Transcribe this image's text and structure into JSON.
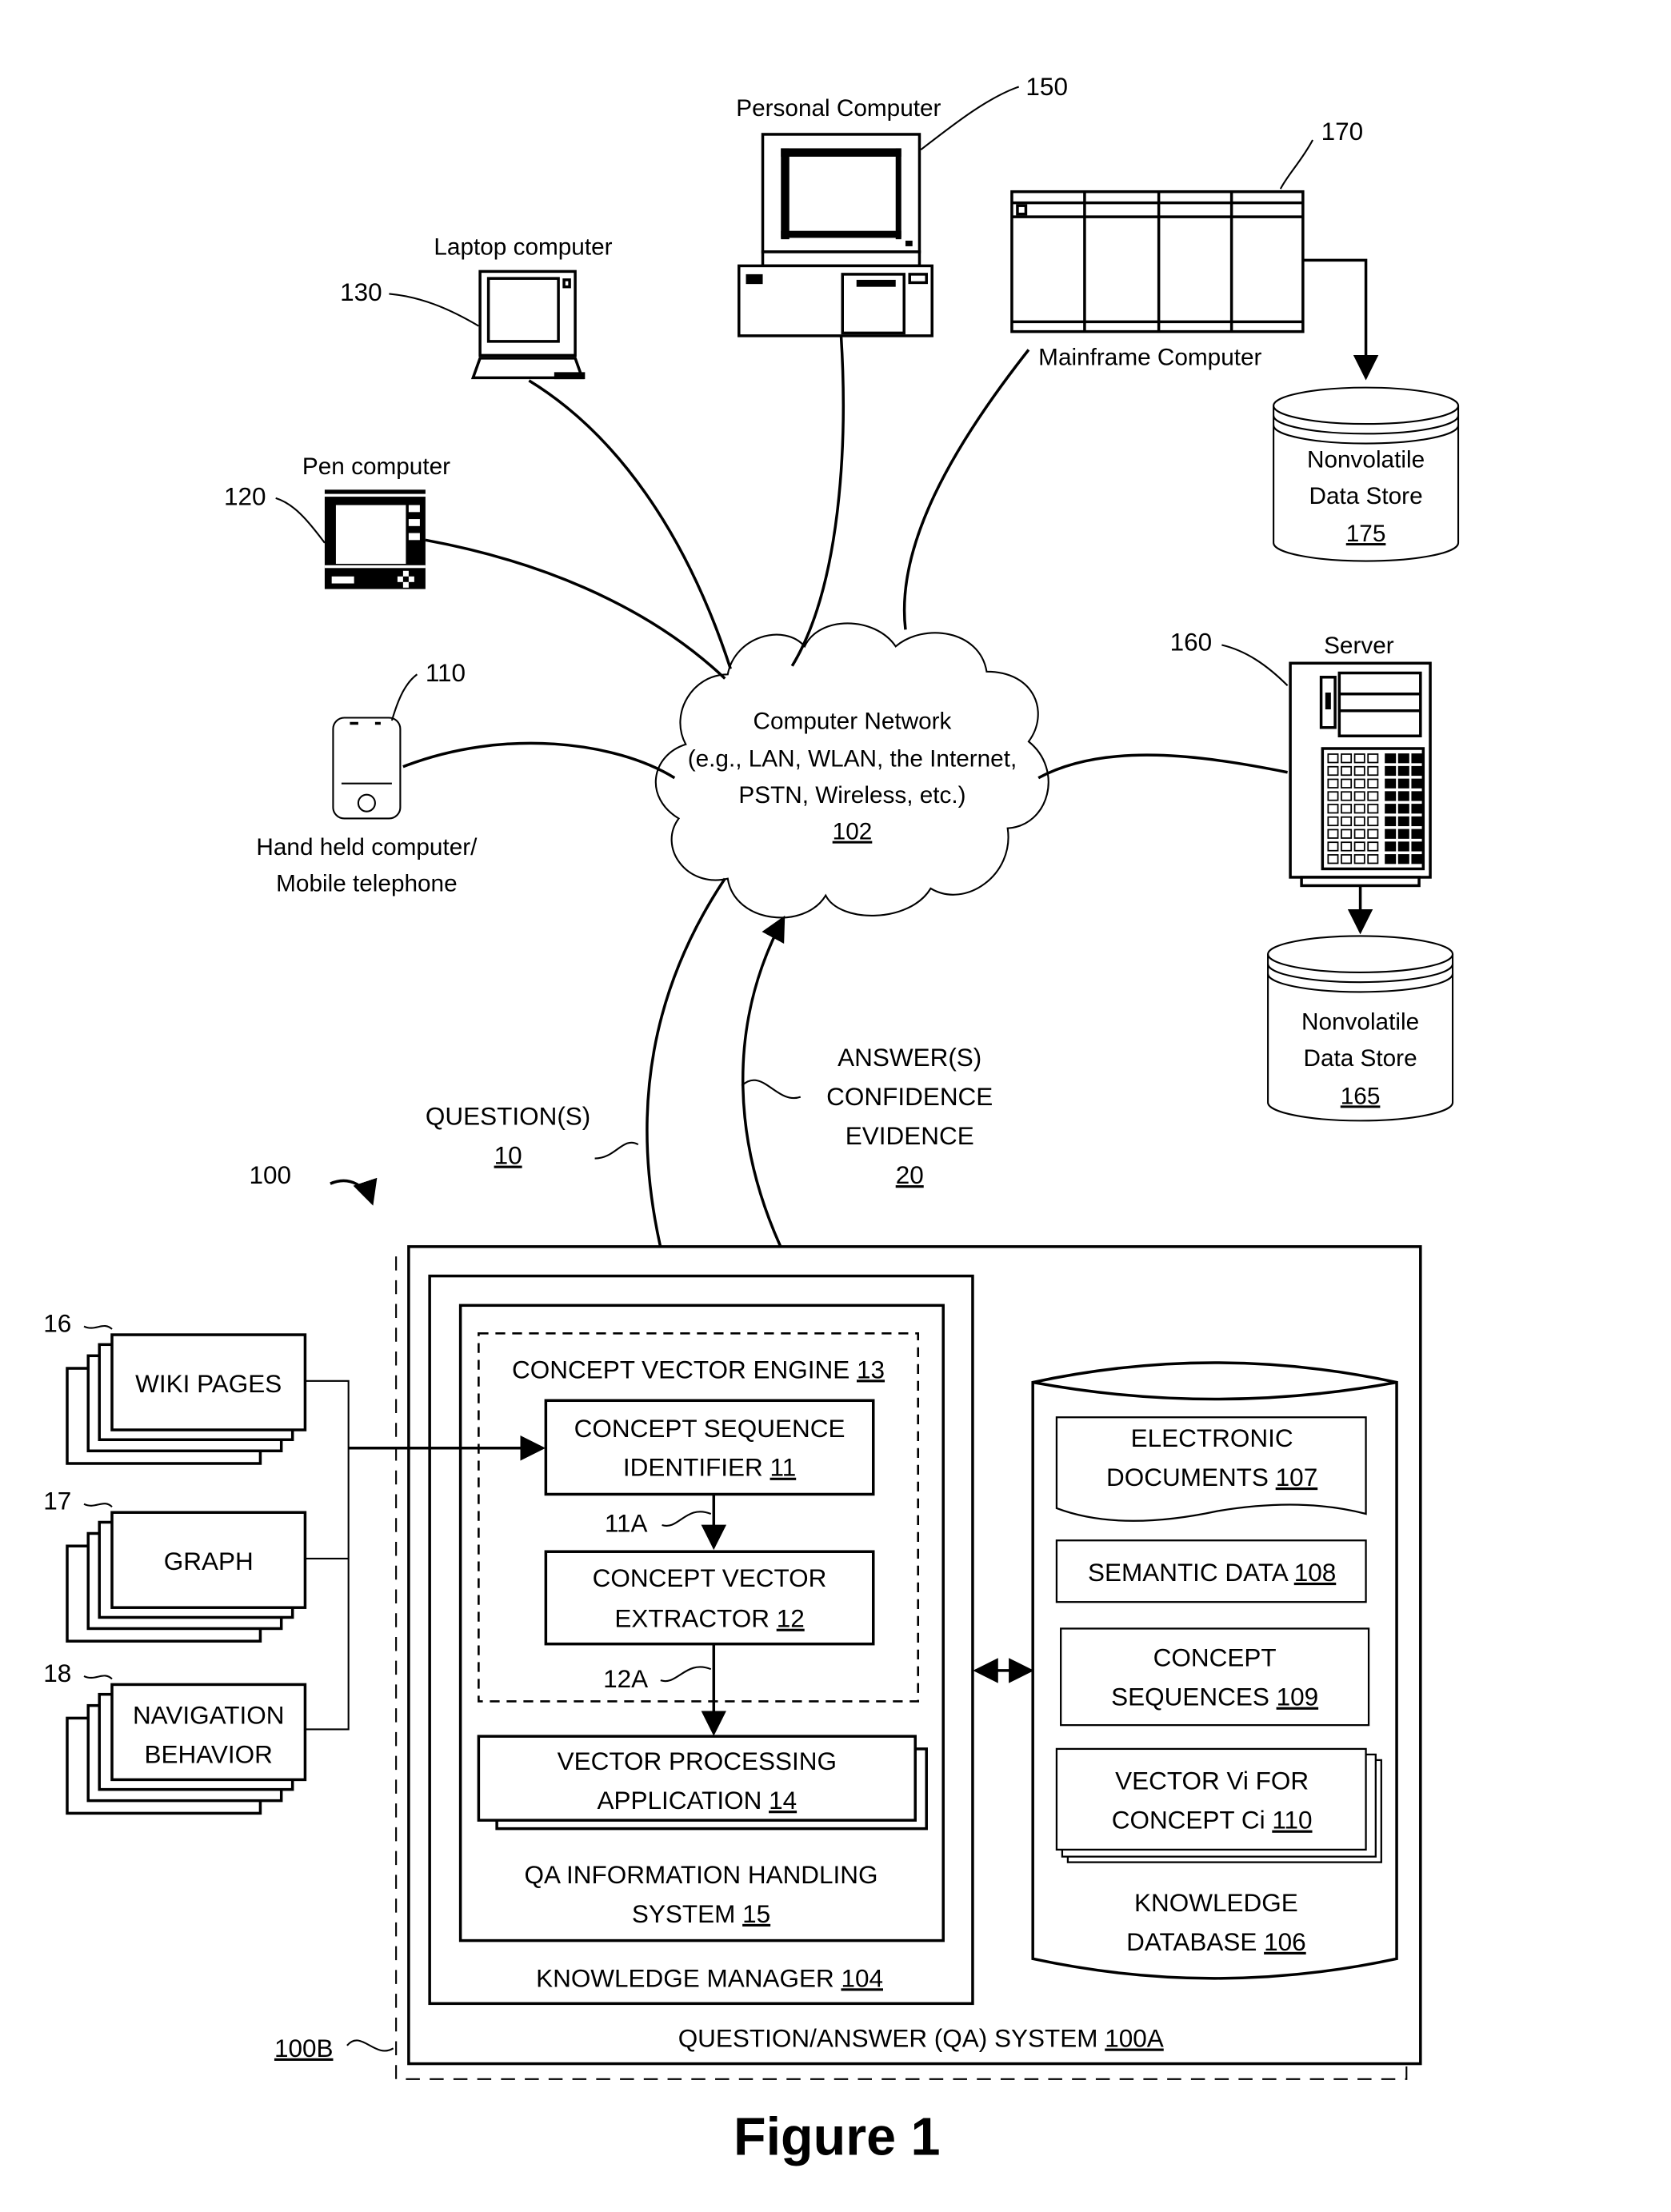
{
  "figure": {
    "caption": "Figure 1",
    "system_ref": "100",
    "outer_ref": "100B"
  },
  "devices": {
    "personal_computer": {
      "label": "Personal Computer",
      "ref": "150"
    },
    "mainframe": {
      "label": "Mainframe Computer",
      "ref": "170"
    },
    "laptop": {
      "label": "Laptop computer",
      "ref": "130"
    },
    "pen": {
      "label": "Pen computer",
      "ref": "120"
    },
    "handheld": {
      "label_line1": "Hand held computer/",
      "label_line2": "Mobile telephone",
      "ref": "110"
    },
    "server": {
      "label": "Server",
      "ref": "160"
    },
    "store_175": {
      "line1": "Nonvolatile",
      "line2": "Data Store",
      "ref": "175"
    },
    "store_165": {
      "line1": "Nonvolatile",
      "line2": "Data Store",
      "ref": "165"
    }
  },
  "network": {
    "line1": "Computer Network",
    "line2": "(e.g., LAN, WLAN, the Internet,",
    "line3": "PSTN, Wireless, etc.)",
    "ref": "102"
  },
  "flows": {
    "questions": {
      "label": "QUESTION(S)",
      "ref": "10"
    },
    "answers": {
      "line1": "ANSWER(S)",
      "line2": "CONFIDENCE",
      "line3": "EVIDENCE",
      "ref": "20"
    }
  },
  "sources": [
    {
      "ref": "16",
      "line1": "WIKI PAGES",
      "line2": ""
    },
    {
      "ref": "17",
      "line1": "GRAPH",
      "line2": ""
    },
    {
      "ref": "18",
      "line1": "NAVIGATION",
      "line2": "BEHAVIOR"
    }
  ],
  "qa_system": {
    "label": "QUESTION/ANSWER (QA) SYSTEM ",
    "ref": "100A",
    "knowledge_manager": {
      "label": "KNOWLEDGE MANAGER ",
      "ref": "104"
    },
    "qa_ihs": {
      "line1": "QA INFORMATION HANDLING",
      "line2": "SYSTEM ",
      "ref": "15"
    },
    "engine": {
      "label": "CONCEPT VECTOR ENGINE ",
      "ref": "13"
    },
    "identifier": {
      "line1": "CONCEPT SEQUENCE",
      "line2": "IDENTIFIER ",
      "ref": "11",
      "out_ref": "11A"
    },
    "extractor": {
      "line1": "CONCEPT VECTOR",
      "line2": "EXTRACTOR ",
      "ref": "12",
      "out_ref": "12A"
    },
    "application": {
      "line1": "VECTOR PROCESSING",
      "line2": "APPLICATION ",
      "ref": "14"
    },
    "knowledge_db": {
      "line1": "KNOWLEDGE",
      "line2": "DATABASE ",
      "ref": "106",
      "items": [
        {
          "line1": "ELECTRONIC",
          "line2": "DOCUMENTS ",
          "ref": "107"
        },
        {
          "line1": "SEMANTIC DATA ",
          "line2": "",
          "ref": "108"
        },
        {
          "line1": "CONCEPT",
          "line2": "SEQUENCES ",
          "ref": "109"
        },
        {
          "line1": "VECTOR Vi FOR",
          "line2": "CONCEPT Ci ",
          "ref": "110"
        }
      ]
    }
  }
}
